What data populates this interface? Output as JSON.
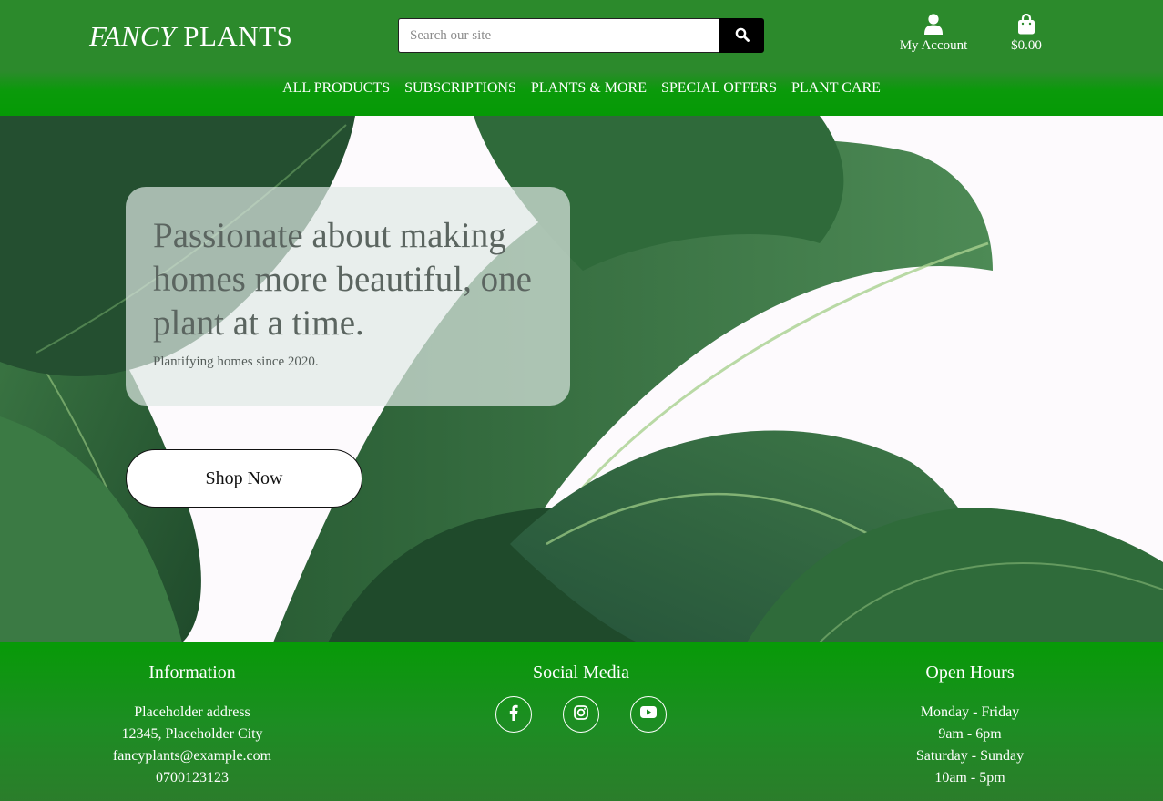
{
  "header": {
    "logo_italic": "FANCY",
    "logo_rest": "PLANTS",
    "search_placeholder": "Search our site",
    "account_label": "My Account",
    "bag_total": "$0.00"
  },
  "nav": {
    "items": [
      "ALL PRODUCTS",
      "SUBSCRIPTIONS",
      "PLANTS & MORE",
      "SPECIAL OFFERS",
      "PLANT CARE"
    ]
  },
  "hero": {
    "title": "Passionate about making homes more beautiful, one plant at a time.",
    "subtitle": "Plantifying homes since 2020.",
    "cta": "Shop Now"
  },
  "footer": {
    "info": {
      "heading": "Information",
      "lines": [
        "Placeholder address",
        "12345, Placeholder City",
        "fancyplants@example.com",
        "0700123123"
      ]
    },
    "social": {
      "heading": "Social Media",
      "icons": [
        "facebook-icon",
        "instagram-icon",
        "youtube-icon"
      ]
    },
    "hours": {
      "heading": "Open Hours",
      "lines": [
        "Monday - Friday",
        "9am - 6pm",
        "Saturday - Sunday",
        "10am - 5pm"
      ]
    }
  },
  "colors": {
    "header_green": "#2c8a2c",
    "nav_green": "#059a05",
    "footer_green": "#079a07",
    "leaf_dark": "#234f2f",
    "leaf_mid": "#3d7a44"
  }
}
